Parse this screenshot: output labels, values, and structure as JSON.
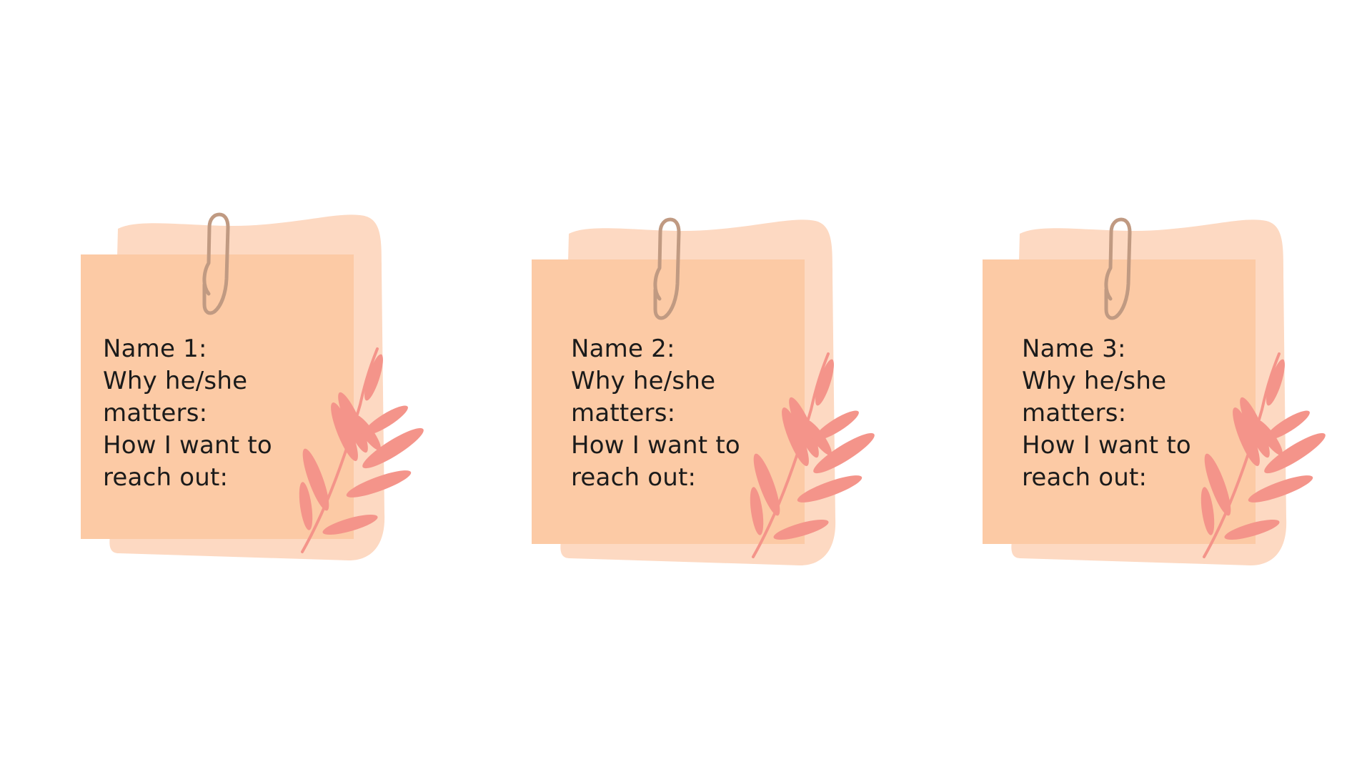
{
  "colors": {
    "background": "#ffffff",
    "sheet_back": "#fdd9c2",
    "sheet_front": "#fccaa5",
    "clip": "#c09a82",
    "leaf": "#f4948a",
    "text": "#1b1b1b"
  },
  "notes": [
    {
      "lines": [
        "Name 1:",
        "Why he/she",
        "matters:",
        "How I want to",
        "reach out:"
      ]
    },
    {
      "lines": [
        "Name 2:",
        "Why he/she",
        "matters:",
        "How I want to",
        "reach out:"
      ]
    },
    {
      "lines": [
        "Name 3:",
        "Why he/she",
        "matters:",
        "How I want to",
        "reach out:"
      ]
    }
  ],
  "icons": {
    "clip": "paperclip-icon",
    "decoration": "leaf-branch-icon"
  }
}
